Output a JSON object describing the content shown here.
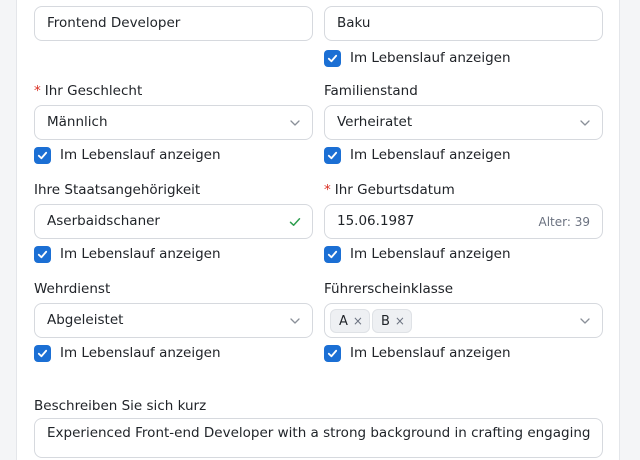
{
  "row1": {
    "left_value": "Frontend Developer",
    "right_value": "Baku",
    "right_show_label": "Im Lebenslauf anzeigen"
  },
  "gender": {
    "label": "Ihr Geschlecht",
    "required_mark": "*",
    "value": "Männlich",
    "show_label": "Im Lebenslauf anzeigen"
  },
  "marital": {
    "label": "Familienstand",
    "value": "Verheiratet",
    "show_label": "Im Lebenslauf anzeigen"
  },
  "citizenship": {
    "label": "Ihre Staatsangehörigkeit",
    "value": "Aserbaidschaner",
    "show_label": "Im Lebenslauf anzeigen"
  },
  "birthdate": {
    "label": "Ihr Geburtsdatum",
    "required_mark": "*",
    "value": "15.06.1987",
    "age": "Alter: 39",
    "show_label": "Im Lebenslauf anzeigen"
  },
  "military": {
    "label": "Wehrdienst",
    "value": "Abgeleistet",
    "show_label": "Im Lebenslauf anzeigen"
  },
  "license": {
    "label": "Führerscheinklasse",
    "tags": [
      "A",
      "B"
    ],
    "remove_glyph": "×",
    "show_label": "Im Lebenslauf anzeigen"
  },
  "description": {
    "label": "Beschreiben Sie sich kurz",
    "value": "Experienced Front-end Developer with a strong background in crafting engaging"
  },
  "colors": {
    "accent": "#1b6fd4",
    "required": "#d92d20",
    "valid": "#2e9e4f"
  }
}
